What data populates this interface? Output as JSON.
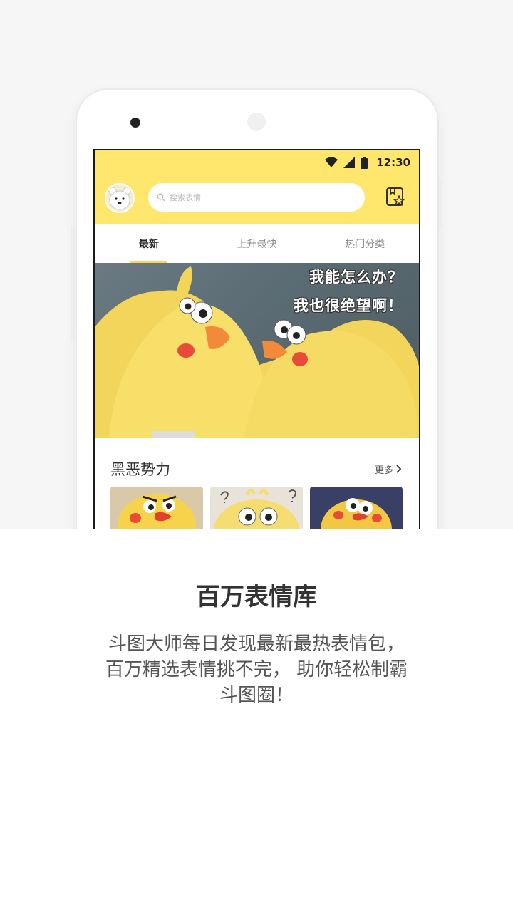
{
  "status_bar": {
    "time": "12:30"
  },
  "app": {
    "search_placeholder": "搜索表情",
    "tabs": [
      {
        "label": "最新",
        "active": true
      },
      {
        "label": "上升最快",
        "active": false
      },
      {
        "label": "热门分类",
        "active": false
      }
    ],
    "banner": {
      "line1": "我能怎么办？",
      "line2": "我也很绝望啊！"
    },
    "section": {
      "title": "黑恶势力",
      "more_label": "更多"
    }
  },
  "promo": {
    "headline": "百万表情库",
    "description_lines": [
      "斗图大师每日发现最新最热表情包，",
      "百万精选表情挑不完， 助你轻松制霸",
      "斗图圈！"
    ]
  },
  "colors": {
    "accent_yellow": "#ffe66c",
    "tab_indicator": "#ffd54a"
  }
}
